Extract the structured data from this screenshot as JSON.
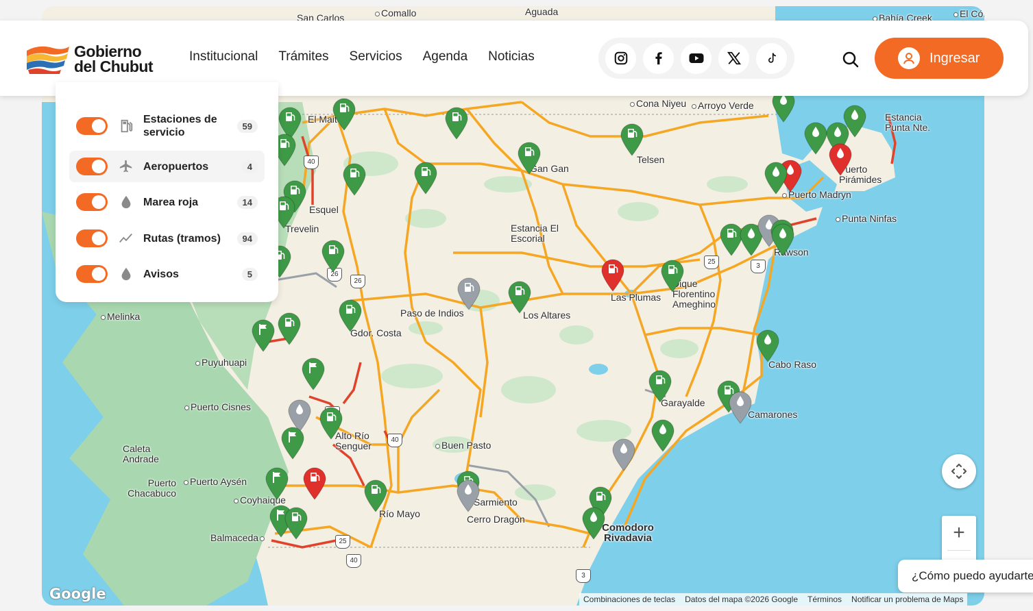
{
  "header": {
    "logo_line1": "Gobierno",
    "logo_line2": "del Chubut",
    "nav": [
      "Institucional",
      "Trámites",
      "Servicios",
      "Agenda",
      "Noticias"
    ],
    "socials": [
      "instagram-icon",
      "facebook-icon",
      "youtube-icon",
      "x-icon",
      "tiktok-icon"
    ],
    "login_label": "Ingresar",
    "accent": "#f26a24"
  },
  "layers": [
    {
      "name": "Estaciones de servicio",
      "count": "59",
      "icon": "fuel-icon"
    },
    {
      "name": "Aeropuertos",
      "count": "4",
      "icon": "plane-icon"
    },
    {
      "name": "Marea roja",
      "count": "14",
      "icon": "drop-icon"
    },
    {
      "name": "Rutas (tramos)",
      "count": "94",
      "icon": "trend-icon"
    },
    {
      "name": "Avisos",
      "count": "5",
      "icon": "drop-icon"
    }
  ],
  "places": [
    {
      "name": "San Carlos"
    },
    {
      "name": "Comallo"
    },
    {
      "name": "Aguada"
    },
    {
      "name": "Bahía Creek"
    },
    {
      "name": "El Cóndor"
    },
    {
      "name": "Cona Niyeu"
    },
    {
      "name": "Arroyo Verde"
    },
    {
      "name": "Estancia Punta Nte."
    },
    {
      "name": "El Maitén"
    },
    {
      "name": "Gan Gan"
    },
    {
      "name": "Telsen"
    },
    {
      "name": "Puerto Pirámides"
    },
    {
      "name": "Puerto Madryn"
    },
    {
      "name": "Punta Ninfas"
    },
    {
      "name": "Esquel"
    },
    {
      "name": "Trevelin"
    },
    {
      "name": "Estancia El Escorial"
    },
    {
      "name": "Rawson"
    },
    {
      "name": "Las Plumas"
    },
    {
      "name": "Dique Florentino Ameghino"
    },
    {
      "name": "Paso de Indios"
    },
    {
      "name": "Los Altares"
    },
    {
      "name": "Melinka"
    },
    {
      "name": "Gdor. Costa"
    },
    {
      "name": "Puyuhuapi"
    },
    {
      "name": "Cabo Raso"
    },
    {
      "name": "Garayalde"
    },
    {
      "name": "Camarones"
    },
    {
      "name": "Puerto Cisnes"
    },
    {
      "name": "Alto Río Senguer"
    },
    {
      "name": "Caleta Andrade"
    },
    {
      "name": "Buen Pasto"
    },
    {
      "name": "Puerto Chacabuco"
    },
    {
      "name": "Puerto Aysén"
    },
    {
      "name": "Coyhaique"
    },
    {
      "name": "Sarmiento"
    },
    {
      "name": "Río Mayo"
    },
    {
      "name": "Cerro Dragón"
    },
    {
      "name": "Comodoro Rivadavia"
    },
    {
      "name": "Balmaceda"
    }
  ],
  "route_shields": [
    "40",
    "25",
    "26",
    "40",
    "3",
    "25",
    "40",
    "26",
    "3",
    "40"
  ],
  "map": {
    "google_logo": "Google",
    "attribution": [
      "Combinaciones de teclas",
      "Datos del mapa ©2026 Google",
      "Términos",
      "Notificar un problema de Maps"
    ],
    "zoom_in": "+",
    "chat_prompt": "¿Cómo puedo ayudarte?"
  },
  "colors": {
    "station": "#3f9a47",
    "alert_red": "#e0302b",
    "inactive_gray": "#9aa0a8",
    "route": "#f5a623",
    "route_red": "#e0432b",
    "water": "#7ecfea",
    "land": "#f4efe3",
    "forest": "#cfe8cc"
  }
}
